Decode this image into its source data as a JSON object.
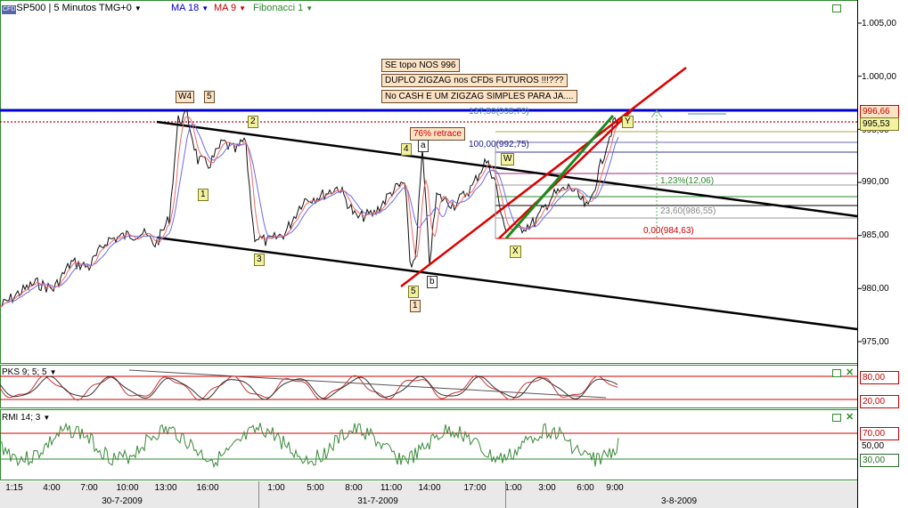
{
  "header": {
    "symbol_badge": "CFD",
    "instrument": "SP500 | 5 Minutos TMG+0",
    "indicators": [
      {
        "label": "MA 18",
        "color": "#0000cc"
      },
      {
        "label": "MA 9",
        "color": "#cc0000"
      },
      {
        "label": "Fibonacci 1",
        "color": "#2a8a2a"
      }
    ]
  },
  "price_axis": {
    "ticks": [
      "1.005,00",
      "1.000,00",
      "995,00",
      "990,00",
      "985,00",
      "980,00",
      "975,00"
    ],
    "tick_values": [
      1005,
      1000,
      995,
      990,
      985,
      980,
      975
    ],
    "current_price": "996,66",
    "last_price": "995,53"
  },
  "annotations": {
    "notes": [
      "SE topo NOS 996",
      "DUPLO ZIGZAG nos CFDs FUTUROS !!!???",
      "No CASH E UM ZIGZAG SIMPLES PARA JA...."
    ],
    "retrace": "76% retrace",
    "fib_labels": [
      "137,50(995,79)",
      "100,00(992,75)",
      "1,23%(12,06)",
      "23,60(986,55)",
      "0,00(984,63)"
    ],
    "wave_labels": [
      "W4",
      "5",
      "2",
      "1",
      "3",
      "4",
      "a",
      "5",
      "1",
      "b",
      "W",
      "X",
      "Y"
    ]
  },
  "oscillators": {
    "pks": {
      "label": "PKS 9; 5; 5",
      "levels": [
        "80,00",
        "20,00"
      ]
    },
    "rmi": {
      "label": "RMI 14; 3",
      "levels": [
        "70,00",
        "50,00",
        "30,00"
      ]
    }
  },
  "time_axis": {
    "ticks": [
      "1:15",
      "4:00",
      "7:00",
      "10:00",
      "13:00",
      "16:00",
      "1:00",
      "5:00",
      "8:00",
      "11:00",
      "14:00",
      "17:00",
      "1:00",
      "3:00",
      "6:00",
      "9:00"
    ],
    "dates": [
      "30-7-2009",
      "31-7-2009",
      "3-8-2009"
    ]
  },
  "chart_data": {
    "type": "line",
    "title": "SP500 | 5 Minutos TMG+0",
    "ylabel": "",
    "xlabel": "",
    "ylim": [
      974,
      1007
    ],
    "price_path": {
      "x_time": [
        "1:15",
        "4:00",
        "7:00",
        "10:00",
        "13:00",
        "14:00",
        "16:00",
        "1:00",
        "5:00",
        "8:00",
        "11:00",
        "12:00",
        "14:00",
        "17:00",
        "18:00",
        "1:00",
        "3:00",
        "6:00",
        "9:00"
      ],
      "values": [
        978.5,
        981,
        980,
        985,
        985,
        996,
        990,
        984.5,
        988,
        987,
        989,
        981,
        988,
        989,
        991,
        986,
        987,
        988,
        996.5
      ]
    },
    "levels": [
      {
        "label": "137,50(995,79)",
        "value": 995.79
      },
      {
        "label": "100,00(992,75)",
        "value": 992.75
      },
      {
        "label": "23,60(986,55)",
        "value": 986.55
      },
      {
        "label": "0,00(984,63)",
        "value": 984.63
      }
    ],
    "series": [
      {
        "name": "MA 18",
        "color": "#0000cc"
      },
      {
        "name": "MA 9",
        "color": "#cc0000"
      },
      {
        "name": "PKS 9; 5; 5",
        "color": "#cc3333"
      },
      {
        "name": "RMI 14; 3",
        "color": "#3a8a3a"
      }
    ]
  }
}
